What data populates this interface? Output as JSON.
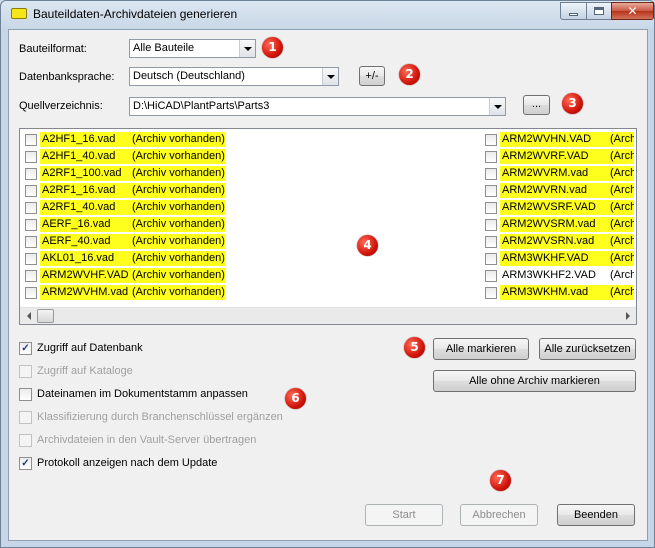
{
  "window": {
    "title": "Bauteildaten-Archivdateien generieren"
  },
  "form": {
    "bauteilformat_label": "Bauteilformat:",
    "bauteilformat_value": "Alle Bauteile",
    "datenbanksprache_label": "Datenbanksprache:",
    "datenbanksprache_value": "Deutsch (Deutschland)",
    "plusminus_label": "+/-",
    "quellverzeichnis_label": "Quellverzeichnis:",
    "quellverzeichnis_value": "D:\\HiCAD\\PlantParts\\Parts3",
    "browse_label": "..."
  },
  "list": {
    "left": [
      {
        "name": "A2HF1_16.vad",
        "status": "(Archiv vorhanden)",
        "highlight": true
      },
      {
        "name": "A2HF1_40.vad",
        "status": "(Archiv vorhanden)",
        "highlight": true
      },
      {
        "name": "A2RF1_100.vad",
        "status": "(Archiv vorhanden)",
        "highlight": true
      },
      {
        "name": "A2RF1_16.vad",
        "status": "(Archiv vorhanden)",
        "highlight": true
      },
      {
        "name": "A2RF1_40.vad",
        "status": "(Archiv vorhanden)",
        "highlight": true
      },
      {
        "name": "AERF_16.vad",
        "status": "(Archiv vorhanden)",
        "highlight": true
      },
      {
        "name": "AERF_40.vad",
        "status": "(Archiv vorhanden)",
        "highlight": true
      },
      {
        "name": "AKL01_16.vad",
        "status": "(Archiv vorhanden)",
        "highlight": true
      },
      {
        "name": "ARM2WVHF.VAD",
        "status": "(Archiv vorhanden)",
        "highlight": true
      },
      {
        "name": "ARM2WVHM.vad",
        "status": "(Archiv vorhanden)",
        "highlight": true
      }
    ],
    "right": [
      {
        "name": "ARM2WVHN.VAD",
        "status": "(Archi",
        "highlight": true
      },
      {
        "name": "ARM2WVRF.VAD",
        "status": "(Archi",
        "highlight": true
      },
      {
        "name": "ARM2WVRM.vad",
        "status": "(Archi",
        "highlight": true
      },
      {
        "name": "ARM2WVRN.vad",
        "status": "(Archi",
        "highlight": true
      },
      {
        "name": "ARM2WVSRF.VAD",
        "status": "(Archi",
        "highlight": true
      },
      {
        "name": "ARM2WVSRM.vad",
        "status": "(Archi",
        "highlight": true
      },
      {
        "name": "ARM2WVSRN.vad",
        "status": "(Archi",
        "highlight": true
      },
      {
        "name": "ARM3WKHF.VAD",
        "status": "(Archi",
        "highlight": true
      },
      {
        "name": "ARM3WKHF2.VAD",
        "status": "(Archi",
        "highlight": false
      },
      {
        "name": "ARM3WKHM.vad",
        "status": "(Archi",
        "highlight": true
      }
    ]
  },
  "options": {
    "zugriff_datenbank": {
      "label": "Zugriff auf Datenbank",
      "checked": true,
      "enabled": true
    },
    "zugriff_kataloge": {
      "label": "Zugriff auf Kataloge",
      "checked": false,
      "enabled": false
    },
    "dateinamen_anpassen": {
      "label": "Dateinamen im Dokumentstamm anpassen",
      "checked": false,
      "enabled": true
    },
    "klassifizierung": {
      "label": "Klassifizierung durch Branchenschlüssel ergänzen",
      "checked": false,
      "enabled": false
    },
    "vault_upload": {
      "label": "Archivdateien in den Vault-Server übertragen",
      "checked": false,
      "enabled": false
    },
    "protokoll": {
      "label": "Protokoll anzeigen nach dem Update",
      "checked": true,
      "enabled": true
    }
  },
  "buttons": {
    "alle_markieren": "Alle markieren",
    "alle_zuruecksetzen": "Alle zurücksetzen",
    "alle_ohne_archiv": "Alle ohne Archiv markieren",
    "start": "Start",
    "abbrechen": "Abbrechen",
    "beenden": "Beenden"
  },
  "badges": [
    "1",
    "2",
    "3",
    "4",
    "5",
    "6",
    "7"
  ],
  "colors": {
    "highlight": "#ffff1e",
    "badge": "#d1140a"
  }
}
